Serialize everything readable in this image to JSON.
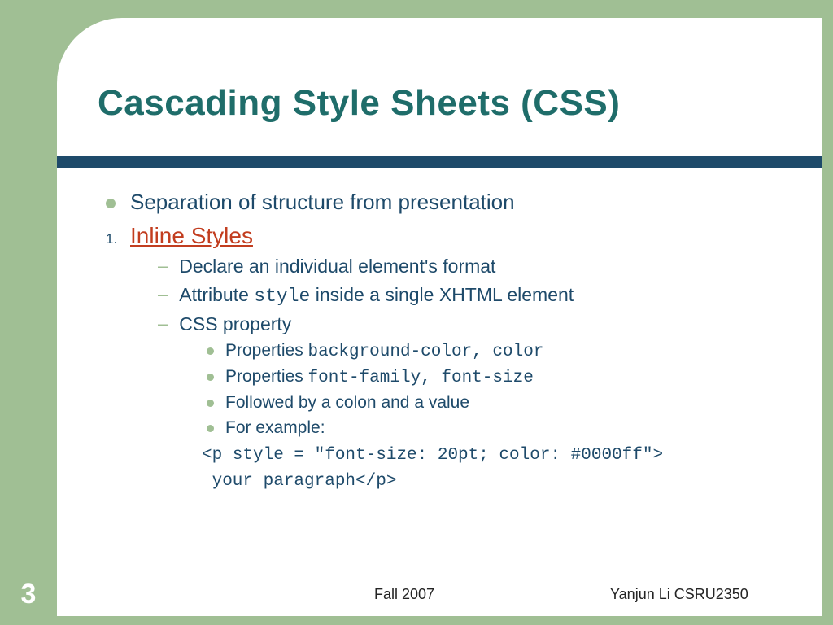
{
  "title": "Cascading Style Sheets (CSS)",
  "bullet1": "Separation of structure from presentation",
  "list_number": "1.",
  "list_link": "Inline Styles",
  "sub1": "Declare an individual element's format",
  "sub2_pre": "Attribute ",
  "sub2_code": "style",
  "sub2_post": "  inside a single XHTML element",
  "sub3": "CSS property",
  "prop1_label": "Properties ",
  "prop1_code": "background-color, color",
  "prop2_label": "Properties ",
  "prop2_code": "font-family, font-size",
  "prop3": "Followed by a colon and a value",
  "prop4": "For example:",
  "example_line1": "<p style = \"font-size: 20pt; color: #0000ff\">",
  "example_line2": " your paragraph</p>",
  "page_number": "3",
  "footer_center": "Fall 2007",
  "footer_right": "Yanjun Li    CSRU2350"
}
